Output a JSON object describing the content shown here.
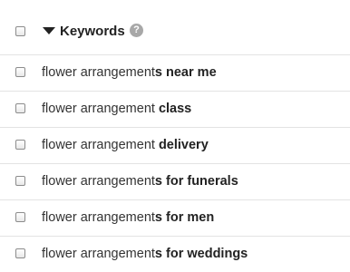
{
  "header": {
    "title": "Keywords",
    "help_glyph": "?",
    "sort_icon": "caret-down-icon",
    "help_icon": "question-circle-icon"
  },
  "rows": [
    {
      "prefix": "flower arrangement",
      "highlight": "s near me"
    },
    {
      "prefix": "flower arrangement ",
      "highlight": "class"
    },
    {
      "prefix": "flower arrangement ",
      "highlight": "delivery"
    },
    {
      "prefix": "flower arrangement",
      "highlight": "s for funerals"
    },
    {
      "prefix": "flower arrangement",
      "highlight": "s for men"
    },
    {
      "prefix": "flower arrangement",
      "highlight": "s for weddings"
    }
  ]
}
